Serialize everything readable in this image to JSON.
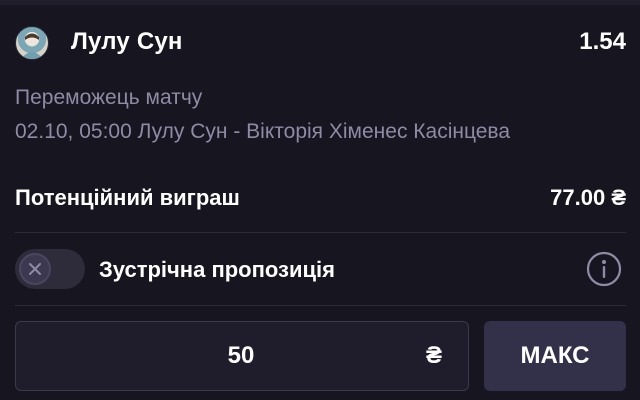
{
  "selection": {
    "player_name": "Лулу Сун",
    "odds": "1.54",
    "market": "Переможець матчу",
    "event": "02.10, 05:00 Лулу Сун - Вікторія Хіменес Касінцева"
  },
  "payout": {
    "label": "Потенційний виграш",
    "value": "77.00 ₴"
  },
  "counter_offer": {
    "label": "Зустрічна пропозиція",
    "enabled": false
  },
  "stake": {
    "value": "50",
    "currency": "₴"
  },
  "max_button": {
    "label": "МАКС"
  },
  "icons": {
    "avatar": "player-avatar",
    "toggle": "close-icon",
    "info": "info-icon"
  },
  "colors": {
    "background": "#17151f",
    "muted_text": "#8f8aa6",
    "input_background": "#1f1c2c",
    "button_background": "#33304a"
  }
}
